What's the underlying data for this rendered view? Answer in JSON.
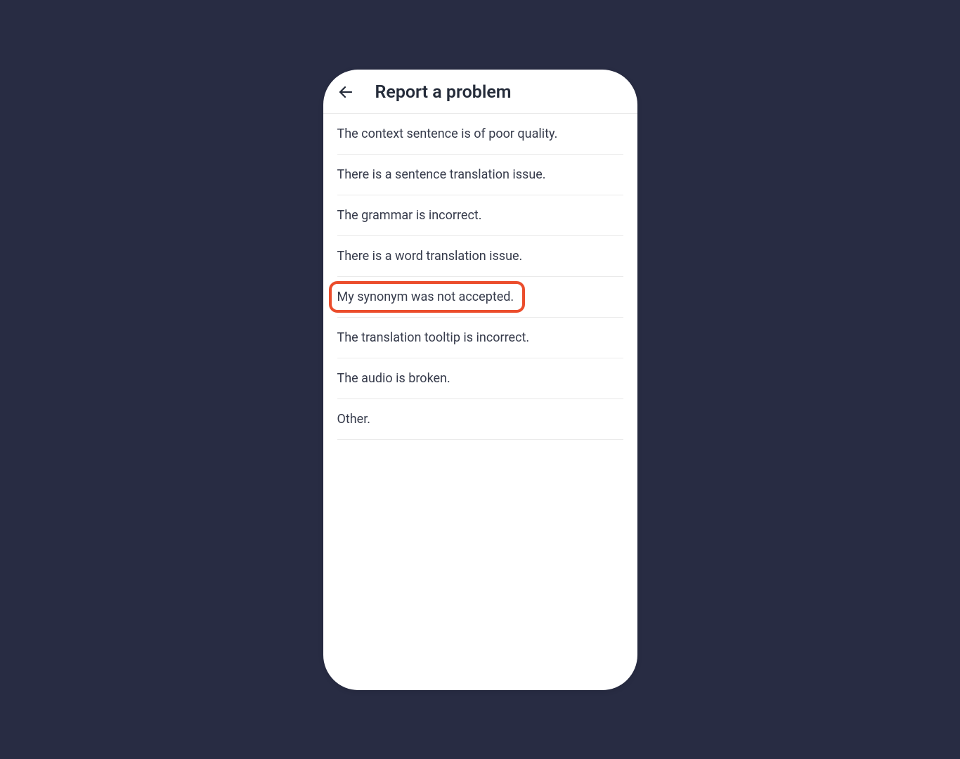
{
  "header": {
    "title": "Report a problem"
  },
  "options": [
    {
      "label": "The context sentence is of poor quality."
    },
    {
      "label": "There is a sentence translation issue."
    },
    {
      "label": "The grammar is incorrect."
    },
    {
      "label": "There is a word translation issue."
    },
    {
      "label": "My synonym was not accepted."
    },
    {
      "label": "The translation tooltip is incorrect."
    },
    {
      "label": "The audio is broken."
    },
    {
      "label": "Other."
    }
  ],
  "highlighted_index": 4
}
